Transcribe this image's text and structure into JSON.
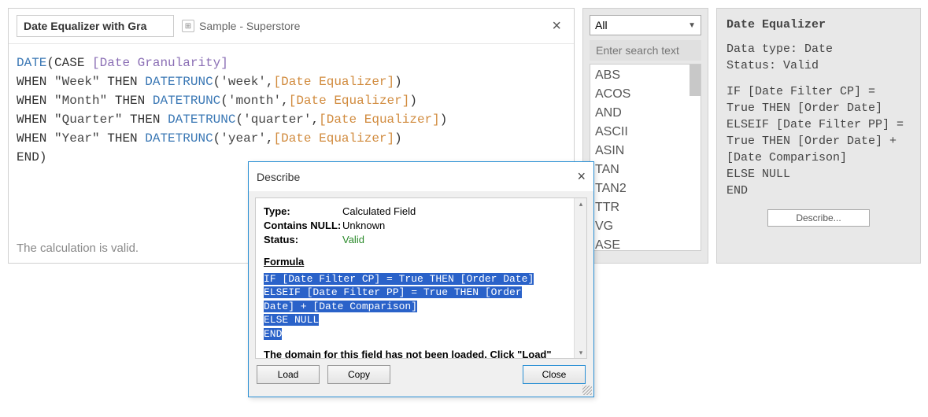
{
  "editor": {
    "field_name": "Date Equalizer with Gra",
    "datasource": "Sample - Superstore",
    "close_glyph": "×",
    "status": "The calculation is valid.",
    "code": {
      "fn_date": "DATE",
      "kw_case": "CASE",
      "param_gran": "[Date Granularity]",
      "kw_when": "WHEN",
      "kw_then": "THEN",
      "fn_trunc": "DATETRUNC",
      "field_eq": "[Date Equalizer]",
      "kw_end": "END",
      "str_week": "\"Week\"",
      "str_month": "\"Month\"",
      "str_quarter": "\"Quarter\"",
      "str_year": "\"Year\"",
      "arg_week": "'week'",
      "arg_month": "'month'",
      "arg_quarter": "'quarter'",
      "arg_year": "'year'"
    }
  },
  "functions": {
    "filter": "All",
    "search_placeholder": "Enter search text",
    "items": [
      "ABS",
      "ACOS",
      "AND",
      "ASCII",
      "ASIN",
      "TAN",
      "TAN2",
      "TTR",
      "VG",
      "ASE"
    ]
  },
  "help": {
    "title": "Date Equalizer",
    "datatype_label": "Data type: ",
    "datatype": "Date",
    "status_label": "Status: ",
    "status": "Valid",
    "formula": "IF [Date Filter CP] = True THEN [Order Date]\nELSEIF [Date Filter PP] = True THEN [Order Date] + [Date Comparison]\nELSE NULL\nEND",
    "describe_label": "Describe..."
  },
  "dialog": {
    "title": "Describe",
    "close_glyph": "×",
    "type_label": "Type:",
    "type_value": "Calculated Field",
    "null_label": "Contains NULL:",
    "null_value": "Unknown",
    "status_label": "Status:",
    "status_value": "Valid",
    "formula_header": "Formula",
    "formula_l1": "IF [Date Filter CP] = True THEN [Order Date]",
    "formula_l2": "ELSEIF [Date Filter PP] = True THEN [Order",
    "formula_l3": "Date] + [Date Comparison]",
    "formula_l4": "ELSE NULL",
    "formula_l5": "END",
    "domain_note": "The domain for this field has not been loaded. Click \"Load\"",
    "load_label": "Load",
    "copy_label": "Copy",
    "close_label": "Close"
  }
}
